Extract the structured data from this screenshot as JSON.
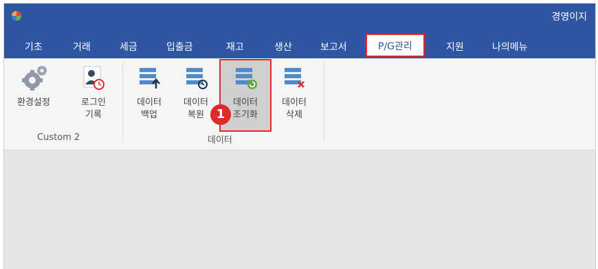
{
  "app": {
    "title": "경영이지"
  },
  "menu": {
    "tabs": [
      {
        "label": "기초"
      },
      {
        "label": "거래"
      },
      {
        "label": "세금"
      },
      {
        "label": "입출금"
      },
      {
        "label": "재고"
      },
      {
        "label": "생산"
      },
      {
        "label": "보고서"
      },
      {
        "label": "P/G관리"
      },
      {
        "label": "지원"
      },
      {
        "label": "나의메뉴"
      }
    ],
    "active_index": 7
  },
  "ribbon": {
    "groups": [
      {
        "label": "Custom 2",
        "buttons": [
          {
            "line1": "환경설정",
            "line2": ""
          },
          {
            "line1": "로그인",
            "line2": "기록"
          }
        ]
      },
      {
        "label": "데이터",
        "buttons": [
          {
            "line1": "데이터",
            "line2": "백업"
          },
          {
            "line1": "데이터",
            "line2": "복원"
          },
          {
            "line1": "데이터",
            "line2": "조기화"
          },
          {
            "line1": "데이터",
            "line2": "삭제"
          }
        ]
      }
    ]
  },
  "annotation": {
    "badge": "1"
  },
  "colors": {
    "titlebar": "#2e56a3",
    "highlight": "#e02a2a"
  }
}
